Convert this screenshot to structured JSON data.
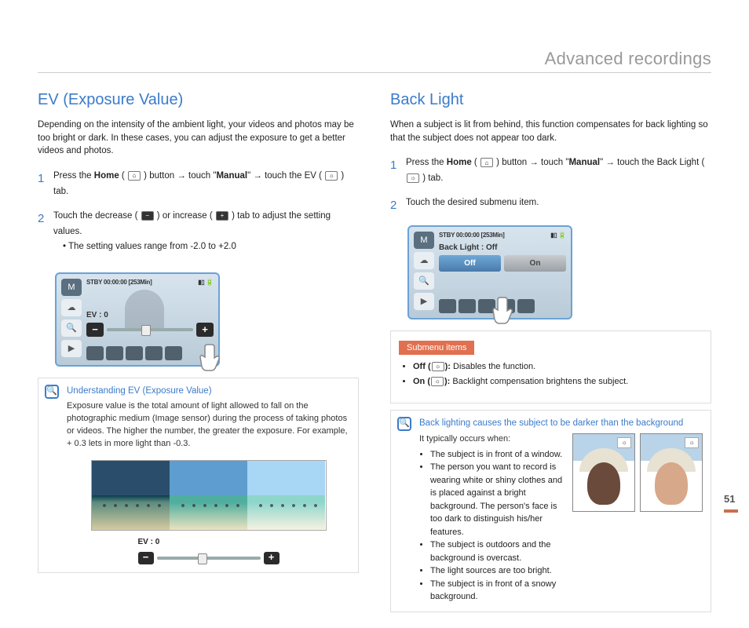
{
  "section_header": "Advanced recordings",
  "page_number": "51",
  "left": {
    "title": "EV (Exposure Value)",
    "intro": "Depending on the intensity of the ambient light, your videos and photos may be too bright or dark. In these cases, you can adjust the exposure to get a better videos and photos.",
    "step1_a": "Press the ",
    "step1_home": "Home",
    "step1_b": " ( ",
    "step1_c": " ) button → touch \"",
    "step1_manual": "Manual",
    "step1_d": "\" → touch the EV ( ",
    "step1_e": " ) tab.",
    "step2": "Touch the decrease ( ",
    "step2_b": " ) or increase ( ",
    "step2_c": " ) tab to adjust the setting values.",
    "bullet1": "The setting values range from -2.0 to +2.0",
    "lcd_stby": "STBY 00:00:00 [253Min]",
    "lcd_ev": "EV : 0",
    "note_title": "Understanding EV (Exposure Value)",
    "note_body": "Exposure value is the total amount of light allowed to fall on the photographic medium (Image sensor) during the process of taking photos or videos. The higher the number, the greater the exposure. For example, + 0.3 lets in more light than -0.3.",
    "mini_ev": "EV : 0"
  },
  "right": {
    "title": "Back Light",
    "intro": "When a subject is lit from behind, this function compensates for back lighting so that the subject does not appear too dark.",
    "step1_a": "Press the ",
    "step1_home": "Home",
    "step1_b": " ( ",
    "step1_c": " ) button → touch \"",
    "step1_manual": "Manual",
    "step1_d": "\" → touch the Back Light ( ",
    "step1_e": " ) tab.",
    "step2": "Touch the desired submenu item.",
    "lcd_stby": "STBY 00:00:00 [253Min]",
    "lcd_bl": "Back Light : Off",
    "lcd_off": "Off",
    "lcd_on": "On",
    "submenu_label": "Submenu items",
    "sm_off_l": "Off (",
    "sm_off_r": "): ",
    "sm_off_t": "Disables the function.",
    "sm_on_l": "On (",
    "sm_on_r": "): ",
    "sm_on_t": "Backlight compensation brightens the subject.",
    "note_title": "Back lighting causes the subject to be darker than the background",
    "occurs": "It typically occurs when:",
    "oc1": "The subject is in front of a window.",
    "oc2": "The person you want to record is wearing white or shiny clothes and is placed against a bright background. The person's face is too dark to distinguish his/her features.",
    "oc3": "The subject is outdoors and the background is overcast.",
    "oc4": "The light sources are too bright.",
    "oc5": "The subject is in front of a snowy background."
  }
}
